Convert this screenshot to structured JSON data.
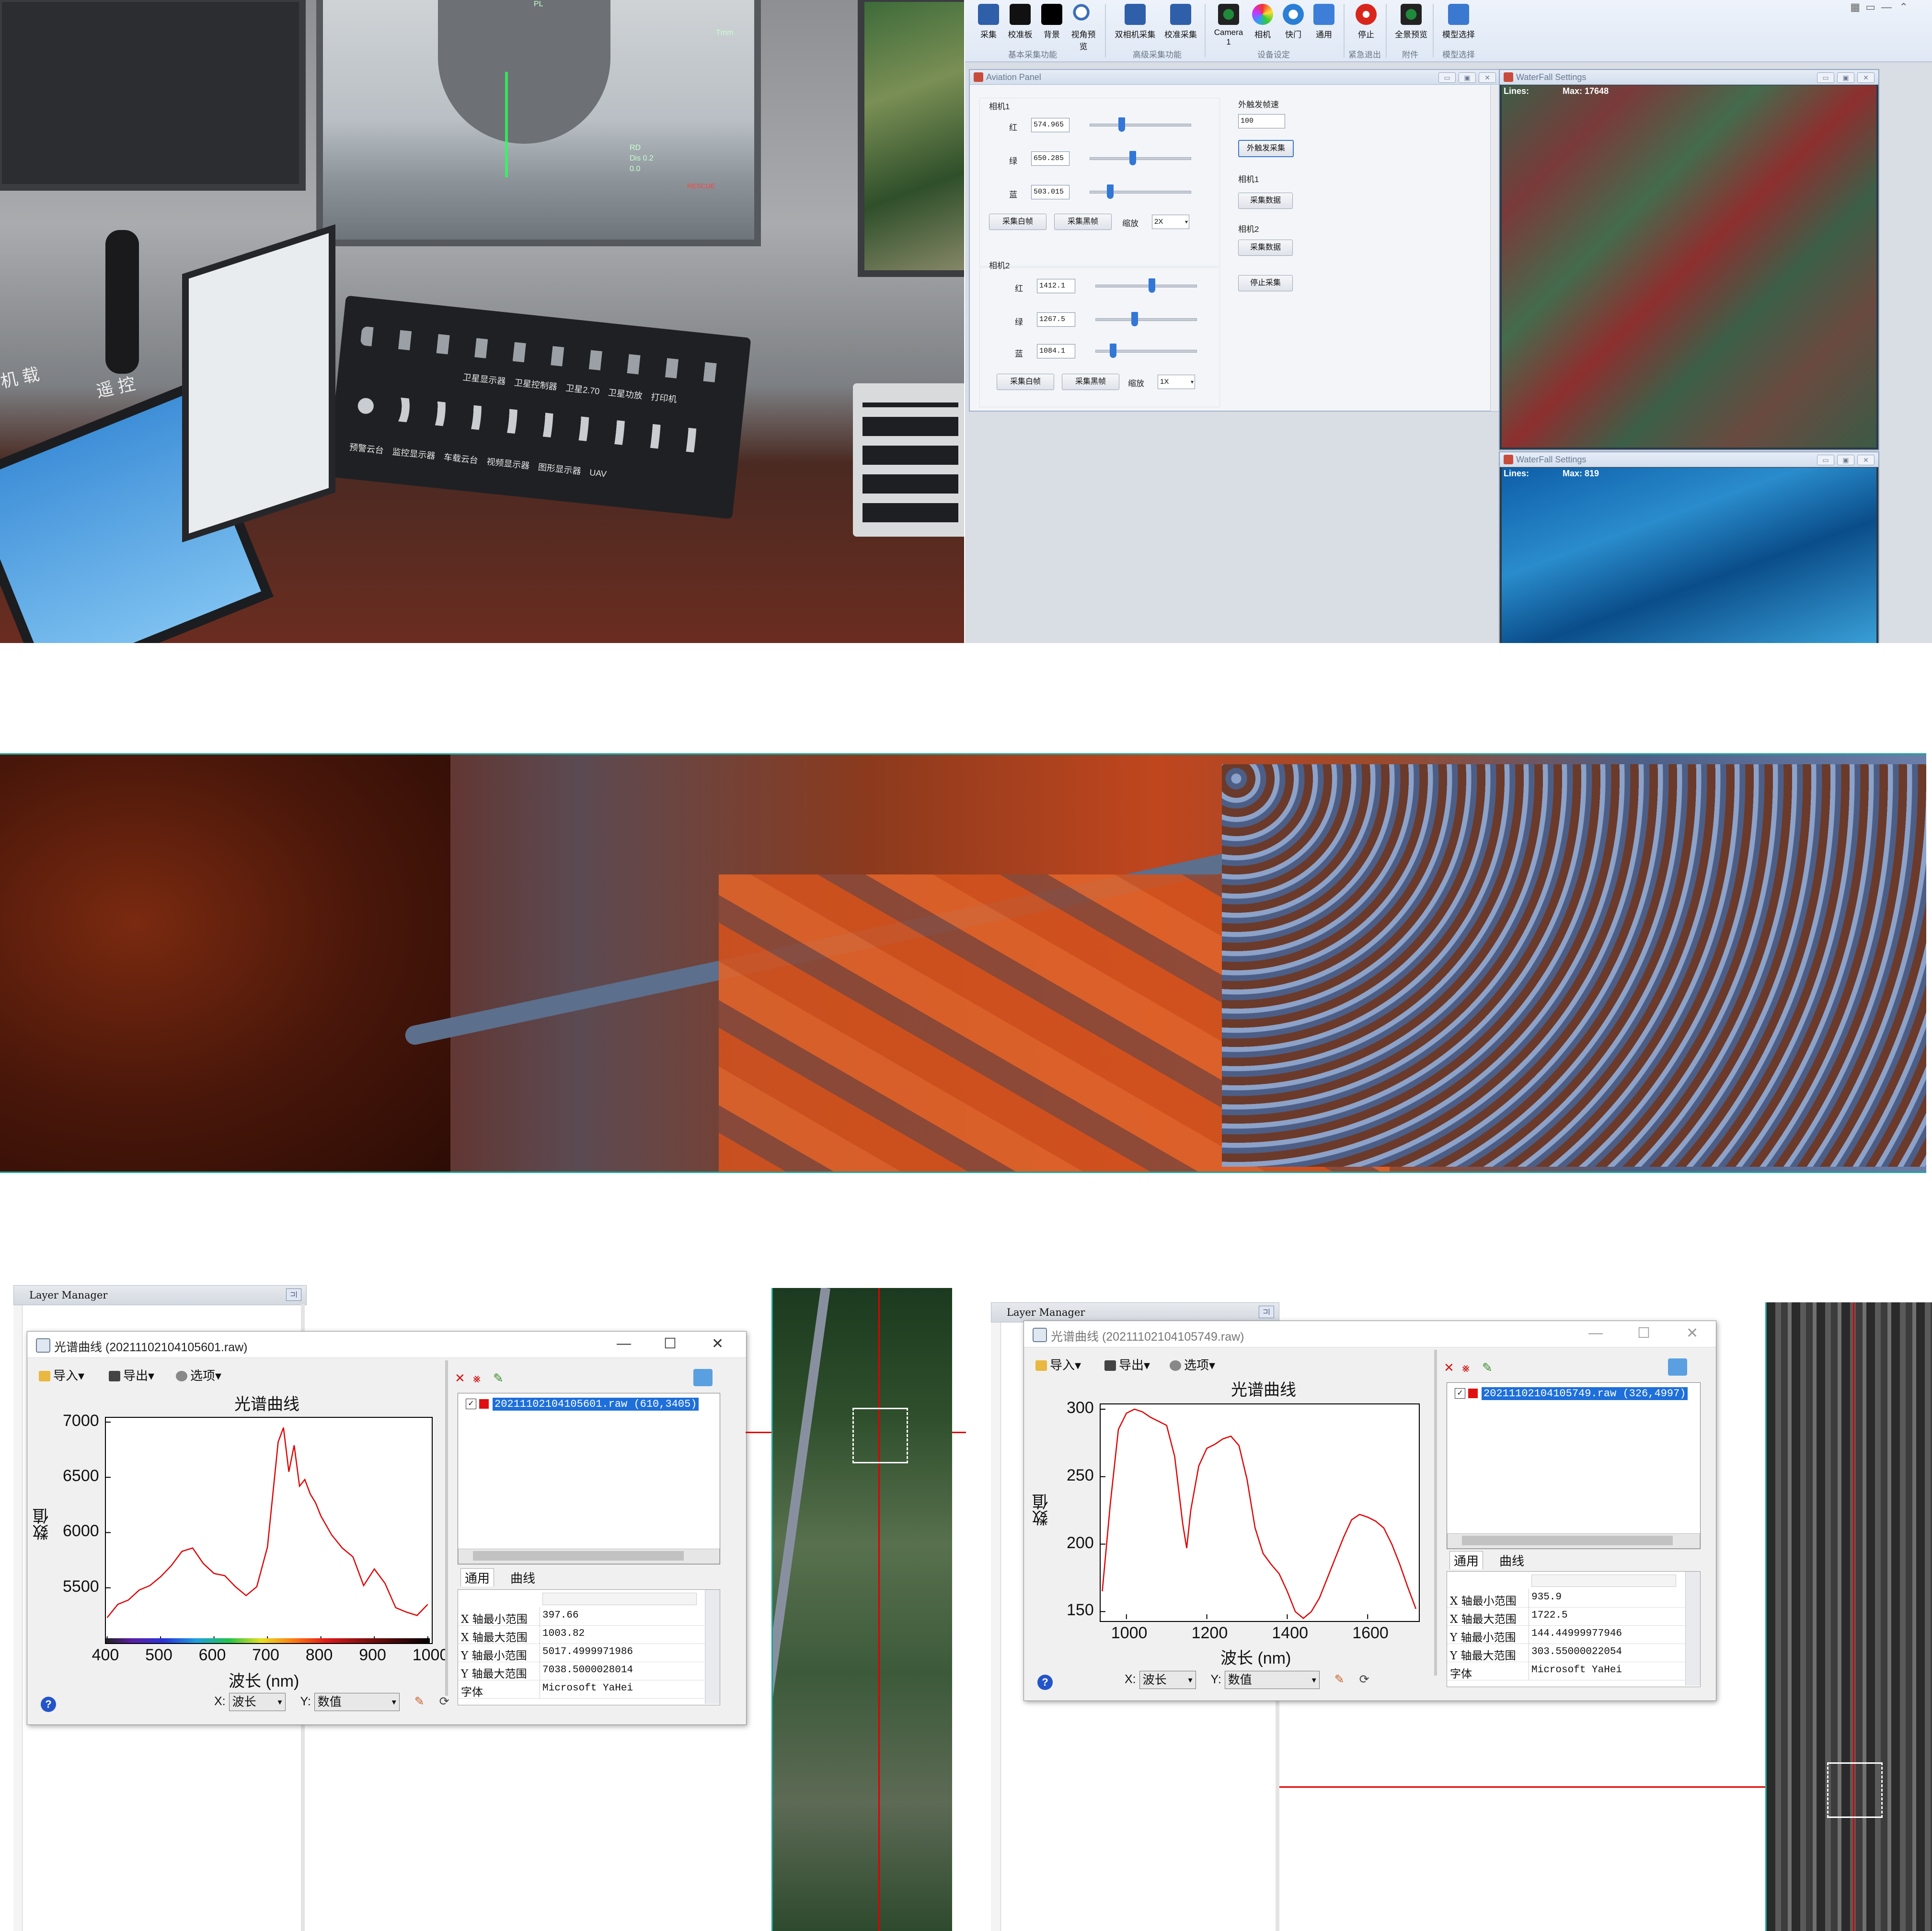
{
  "colors": {
    "teal_border": "#1aa79a",
    "curve": "#e00000",
    "selection": "#1e6fd9",
    "focus_blue": "#3a78d0"
  },
  "cockpit_photo": {
    "labels": [
      "遥 控",
      "机 载",
      "RD",
      "Dis 0.2",
      "0.0",
      "Tmm",
      "PL",
      "预警云台",
      "监控显示器",
      "车载云台",
      "视频显示器",
      "图形显示器",
      "UAV",
      "卫星显示器",
      "卫星控制器",
      "卫星2.70",
      "卫星功放",
      "打印机",
      "RESCUE"
    ]
  },
  "ribbon": {
    "groups": [
      {
        "name": "基本采集功能",
        "buttons": [
          "采集",
          "校准板",
          "背景",
          "视角预览"
        ]
      },
      {
        "name": "高级采集功能",
        "buttons": [
          "双相机采集",
          "校准采集"
        ]
      },
      {
        "name": "设备设定",
        "buttons": [
          "Camera 1",
          "相机",
          "快门",
          "通用"
        ]
      },
      {
        "name": "紧急退出",
        "buttons": [
          "停止"
        ]
      },
      {
        "name": "附件",
        "buttons": [
          "全景预览"
        ]
      },
      {
        "name": "模型选择",
        "buttons": [
          "模型选择"
        ]
      }
    ],
    "window_controls": [
      "▦",
      "▭",
      "—",
      "⌃"
    ]
  },
  "aviation_panel": {
    "title": "Aviation Panel",
    "camera1": {
      "label": "相机1",
      "rows": [
        {
          "label": "红",
          "value": "574.965",
          "level": 0.3
        },
        {
          "label": "绿",
          "value": "650.285",
          "level": 0.42
        },
        {
          "label": "蓝",
          "value": "503.015",
          "level": 0.18
        }
      ],
      "white_btn": "采集白帧",
      "dark_btn": "采集黑帧",
      "zoom_label": "缩放",
      "zoom_value": "2X"
    },
    "camera2": {
      "label": "相机2",
      "rows": [
        {
          "label": "红",
          "value": "1412.1",
          "level": 0.56
        },
        {
          "label": "绿",
          "value": "1267.5",
          "level": 0.38
        },
        {
          "label": "蓝",
          "value": "1084.1",
          "level": 0.15
        }
      ],
      "white_btn": "采集白帧",
      "dark_btn": "采集黑帧",
      "zoom_label": "缩放",
      "zoom_value": "1X"
    },
    "right": {
      "trigger_label": "外触发帧速",
      "trigger_value": "100",
      "trigger_btn": "外触发采集",
      "cam1_label": "相机1",
      "cam1_btn": "采集数据",
      "cam2_label": "相机2",
      "cam2_btn": "采集数据",
      "stop_btn": "停止采集"
    }
  },
  "waterfall": [
    {
      "title": "WaterFall Settings",
      "lines_label": "Lines:",
      "max_label": "Max: 17648"
    },
    {
      "title": "WaterFall Settings",
      "lines_label": "Lines:",
      "max_label": "Max: 819"
    }
  ],
  "left_analysis": {
    "layer_manager": "Layer Manager",
    "window_title": "光谱曲线 (20211102104105601.raw)",
    "toolbar": [
      "导入▾",
      "导出▾",
      "选项▾"
    ],
    "plot": {
      "title": "光谱曲线",
      "ylabel": "数值",
      "xlabel": "波长 (nm)"
    },
    "list_item": "20211102104105601.raw (610,3405)",
    "tabs": [
      "通用",
      "曲线"
    ],
    "props": [
      {
        "k": "X 轴最小范围",
        "v": "397.66"
      },
      {
        "k": "X 轴最大范围",
        "v": "1003.82"
      },
      {
        "k": "Y 轴最小范围",
        "v": "5017.4999971986"
      },
      {
        "k": "Y 轴最大范围",
        "v": "7038.5000028014"
      },
      {
        "k": "字体",
        "v": "Microsoft YaHei"
      }
    ],
    "x_label": "X:",
    "x_value": "波长",
    "y_label": "Y:",
    "y_value": "数值",
    "help": "?"
  },
  "right_analysis": {
    "layer_manager": "Layer Manager",
    "window_title": "光谱曲线 (20211102104105749.raw)",
    "toolbar": [
      "导入▾",
      "导出▾",
      "选项▾"
    ],
    "plot": {
      "title": "光谱曲线",
      "ylabel": "数值",
      "xlabel": "波长 (nm)"
    },
    "list_item": "20211102104105749.raw (326,4997)",
    "tabs": [
      "通用",
      "曲线"
    ],
    "props": [
      {
        "k": "X 轴最小范围",
        "v": "935.9"
      },
      {
        "k": "X 轴最大范围",
        "v": "1722.5"
      },
      {
        "k": "Y 轴最小范围",
        "v": "144.44999977946"
      },
      {
        "k": "Y 轴最大范围",
        "v": "303.55000022054"
      },
      {
        "k": "字体",
        "v": "Microsoft YaHei"
      }
    ],
    "x_label": "X:",
    "x_value": "波长",
    "y_label": "Y:",
    "y_value": "数值",
    "help": "?"
  },
  "chart_data": [
    {
      "type": "line",
      "title": "光谱曲线",
      "xlabel": "波长 (nm)",
      "ylabel": "数值",
      "xlim": [
        397.66,
        1003.82
      ],
      "ylim": [
        5017.5,
        7038.5
      ],
      "xticks": [
        400,
        500,
        600,
        700,
        800,
        900,
        1000
      ],
      "yticks": [
        5500,
        6000,
        6500,
        7000
      ],
      "series": [
        {
          "x": [
            400,
            420,
            440,
            460,
            480,
            500,
            520,
            540,
            560,
            580,
            600,
            620,
            640,
            660,
            680,
            700,
            720,
            730,
            740,
            750,
            760,
            770,
            780,
            790,
            800,
            820,
            840,
            860,
            880,
            900,
            920,
            940,
            960,
            980,
            1000
          ],
          "values": [
            5230,
            5350,
            5390,
            5480,
            5520,
            5600,
            5700,
            5830,
            5860,
            5720,
            5630,
            5610,
            5510,
            5430,
            5510,
            5870,
            6820,
            6950,
            6550,
            6790,
            6420,
            6480,
            6350,
            6270,
            6150,
            5980,
            5860,
            5780,
            5520,
            5670,
            5540,
            5320,
            5280,
            5250,
            5350
          ]
        }
      ]
    },
    {
      "type": "line",
      "title": "光谱曲线",
      "xlabel": "波长 (nm)",
      "ylabel": "数值",
      "xlim": [
        935.9,
        1722.5
      ],
      "ylim": [
        144.45,
        303.55
      ],
      "xticks": [
        1000,
        1200,
        1400,
        1600
      ],
      "yticks": [
        150,
        200,
        250,
        300
      ],
      "series": [
        {
          "x": [
            940,
            960,
            980,
            1000,
            1020,
            1040,
            1060,
            1080,
            1100,
            1120,
            1140,
            1150,
            1160,
            1180,
            1200,
            1220,
            1240,
            1260,
            1280,
            1300,
            1320,
            1340,
            1360,
            1380,
            1400,
            1420,
            1440,
            1460,
            1480,
            1500,
            1520,
            1540,
            1560,
            1580,
            1600,
            1620,
            1640,
            1660,
            1680,
            1700,
            1720
          ],
          "values": [
            165,
            230,
            285,
            297,
            300,
            298,
            294,
            291,
            288,
            265,
            215,
            197,
            225,
            258,
            271,
            274,
            278,
            280,
            273,
            248,
            212,
            193,
            185,
            178,
            165,
            150,
            145,
            150,
            160,
            175,
            190,
            205,
            218,
            222,
            220,
            217,
            212,
            200,
            185,
            168,
            152
          ]
        }
      ]
    }
  ]
}
